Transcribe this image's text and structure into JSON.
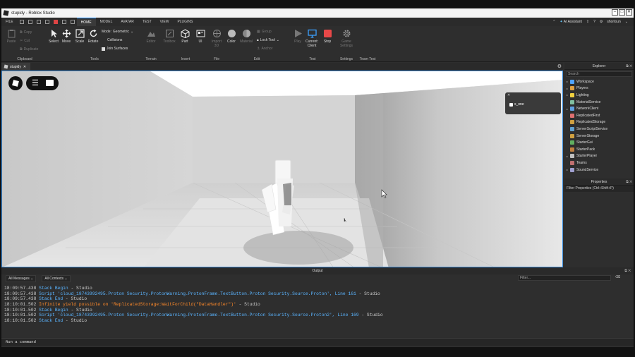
{
  "window": {
    "title": "stupidy - Roblox Studio"
  },
  "menubar": {
    "items": [
      "FILE",
      "HOME",
      "MODEL",
      "AVATAR",
      "TEST",
      "VIEW",
      "PLUGINS"
    ],
    "active": "HOME",
    "ai_assistant": "AI Assistant",
    "username": "shortoun"
  },
  "ribbon": {
    "clipboard": {
      "paste": "Paste",
      "copy": "Copy",
      "cut": "Cut",
      "duplicate": "Duplicate",
      "label": "Clipboard"
    },
    "tools": {
      "select": "Select",
      "move": "Move",
      "scale": "Scale",
      "rotate": "Rotate",
      "mode_label": "Mode:",
      "mode_value": "Geometric",
      "collisions": "Collisions",
      "join_surfaces": "Join Surfaces",
      "label": "Tools"
    },
    "terrain": {
      "editor": "Editor",
      "label": "Terrain"
    },
    "insert": {
      "toolbox": "Toolbox",
      "part": "Part",
      "ui": "UI",
      "label": "Insert"
    },
    "file": {
      "import_3d": "Import 3D",
      "label": "File"
    },
    "edit": {
      "color": "Color",
      "material": "Material",
      "group": "Group",
      "lock_tool": "Lock Tool",
      "anchor": "Anchor",
      "label": "Edit"
    },
    "test": {
      "play": "Play",
      "current_client": "Current: Client",
      "stop": "Stop",
      "label": "Test"
    },
    "settings": {
      "game_settings": "Game Settings",
      "label": "Settings"
    },
    "team_test": {
      "label": "Team Test"
    }
  },
  "doc_tab": {
    "label": "stupidy"
  },
  "viewport": {
    "player_name": "s_one"
  },
  "explorer": {
    "title": "Explorer",
    "search_placeholder": "Search",
    "items": [
      {
        "label": "Workspace",
        "expandable": true,
        "color": "#4fa3ff"
      },
      {
        "label": "Players",
        "expandable": true,
        "color": "#e0a040"
      },
      {
        "label": "Lighting",
        "expandable": true,
        "color": "#f0d040"
      },
      {
        "label": "MaterialService",
        "expandable": false,
        "color": "#80c0a0"
      },
      {
        "label": "NetworkClient",
        "expandable": true,
        "color": "#60a0e0"
      },
      {
        "label": "ReplicatedFirst",
        "expandable": false,
        "color": "#e07070"
      },
      {
        "label": "ReplicatedStorage",
        "expandable": false,
        "color": "#d0a040"
      },
      {
        "label": "ServerScriptService",
        "expandable": false,
        "color": "#60a0d0"
      },
      {
        "label": "ServerStorage",
        "expandable": false,
        "color": "#d0a040"
      },
      {
        "label": "StarterGui",
        "expandable": false,
        "color": "#60b060"
      },
      {
        "label": "StarterPack",
        "expandable": false,
        "color": "#c08040"
      },
      {
        "label": "StarterPlayer",
        "expandable": true,
        "color": "#c0c0c0"
      },
      {
        "label": "Teams",
        "expandable": false,
        "color": "#c07070"
      },
      {
        "label": "SoundService",
        "expandable": true,
        "color": "#a0a0d0"
      }
    ]
  },
  "properties": {
    "title": "Properties",
    "filter_placeholder": "Filter Properties (Ctrl+Shift+P)"
  },
  "output": {
    "title": "Output",
    "filter_messages": "All Messages",
    "filter_contexts": "All Contexts",
    "filter_placeholder": "Filter...",
    "lines": [
      {
        "time": "18:09:57.438",
        "type": "info",
        "text": "Stack Begin",
        "source": "  -  Studio"
      },
      {
        "time": "18:09:57.438",
        "type": "info",
        "text": "Script 'cloud_18743992495.Proton Security.ProtonWarning.ProtonFrame.TextButton.Proton Security.Source.Proton', Line 161",
        "source": "  -  Studio"
      },
      {
        "time": "18:09:57.438",
        "type": "info",
        "text": "Stack End",
        "source": "  -  Studio"
      },
      {
        "time": "18:10:01.502",
        "type": "warn",
        "text": "Infinite yield possible on 'ReplicatedStorage:WaitForChild(\"DataHandler\")'",
        "source": "  -  Studio"
      },
      {
        "time": "18:10:01.502",
        "type": "info",
        "text": "Stack Begin",
        "source": "  -  Studio"
      },
      {
        "time": "18:10:01.502",
        "type": "info",
        "text": "Script 'cloud_18743992495.Proton Security.ProtonWarning.ProtonFrame.TextButton.Proton Security.Source.Proton2', Line 169",
        "source": "  -  Studio"
      },
      {
        "time": "18:10:01.502",
        "type": "info",
        "text": "Stack End",
        "source": "  -  Studio"
      }
    ],
    "command_placeholder": "Run a command"
  }
}
